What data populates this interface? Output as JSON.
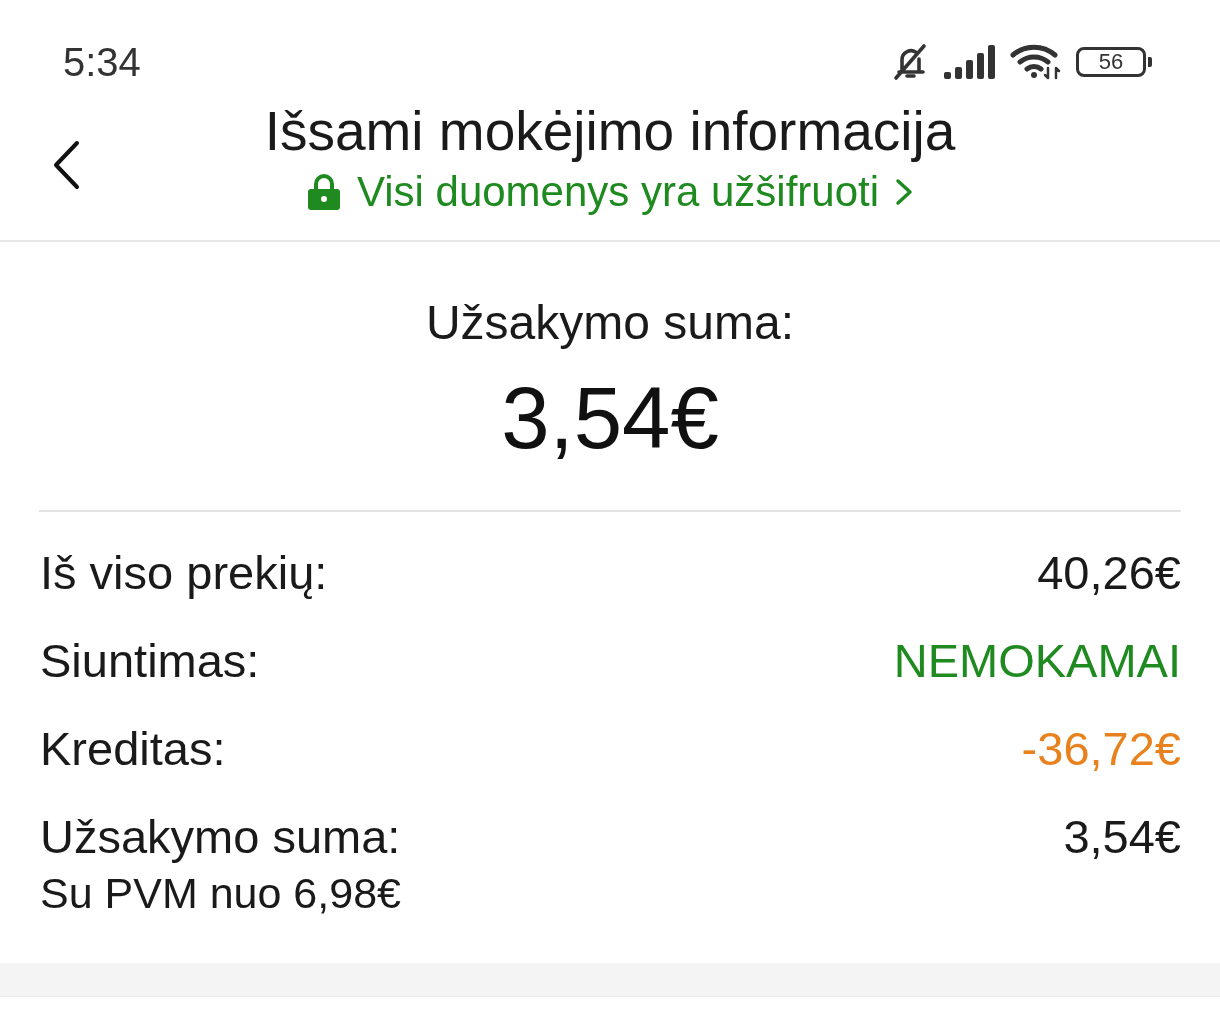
{
  "status_bar": {
    "time": "5:34",
    "battery": "56"
  },
  "header": {
    "title": "Išsami mokėjimo informacija",
    "subtitle": "Visi duomenys yra užšifruoti"
  },
  "summary": {
    "label": "Užsakymo suma:",
    "amount": "3,54€"
  },
  "rows": [
    {
      "label": "Iš viso prekių:",
      "value": "40,26€",
      "color": "#1a1a1a"
    },
    {
      "label": "Siuntimas:",
      "value": "NEMOKAMAI",
      "color": "#1f8a1f"
    },
    {
      "label": "Kreditas:",
      "value": "-36,72€",
      "color": "#e8821e"
    },
    {
      "label": "Užsakymo suma:",
      "value": "3,54€",
      "note": "Su PVM nuo 6,98€",
      "color": "#1a1a1a"
    }
  ]
}
